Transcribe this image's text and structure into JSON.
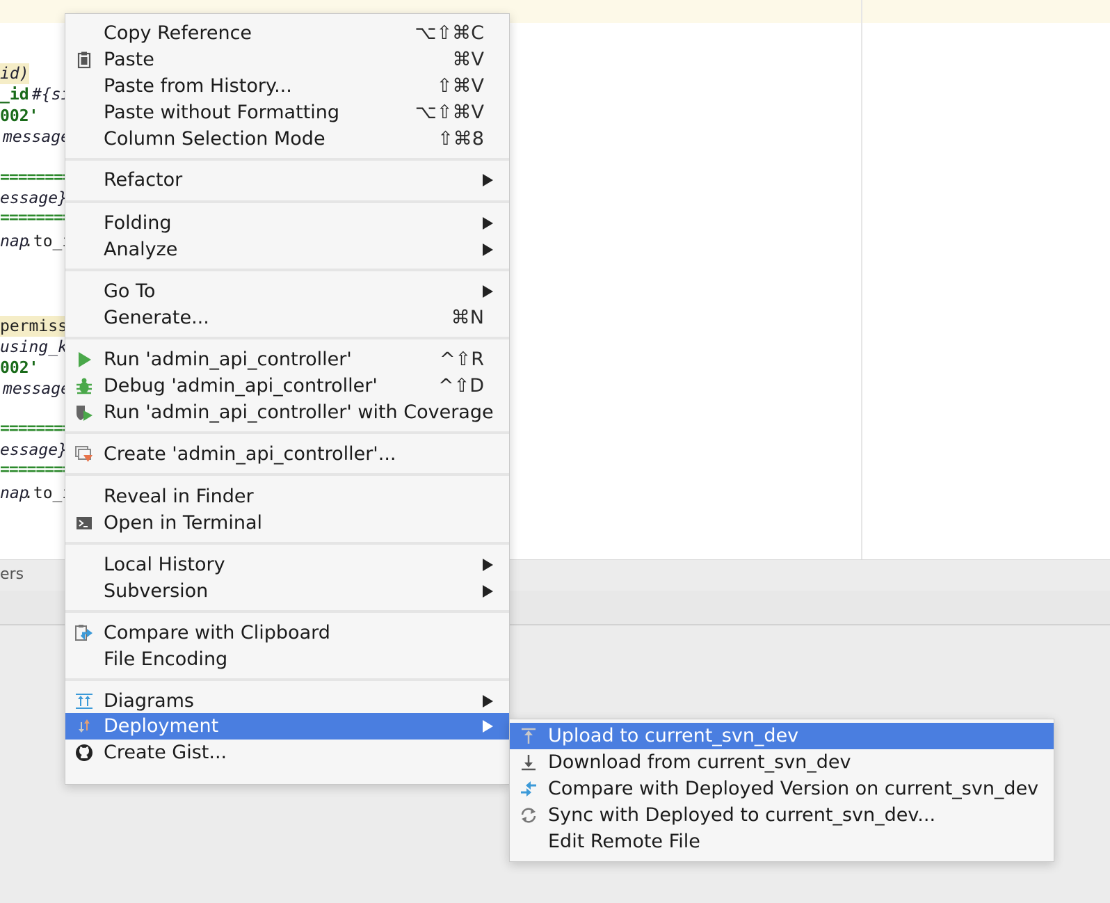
{
  "editor": {
    "code_fragments": [
      "id)",
      "_id",
      "#{si",
      "002'",
      "message",
      "essage}'",
      "nap",
      ".to_i",
      "permiss",
      "using_ke",
      "002'",
      "message",
      "essage}'",
      "nap",
      ".to_i"
    ],
    "separator_text": "=========="
  },
  "tool_window": {
    "tab_label": "ers"
  },
  "context_menu": {
    "items": [
      {
        "label": "Copy Reference",
        "shortcut": "⌥⇧⌘C"
      },
      {
        "label": "Paste",
        "shortcut": "⌘V",
        "icon": "clipboard-icon"
      },
      {
        "label": "Paste from History...",
        "shortcut": "⇧⌘V"
      },
      {
        "label": "Paste without Formatting",
        "shortcut": "⌥⇧⌘V"
      },
      {
        "label": "Column Selection Mode",
        "shortcut": "⇧⌘8"
      },
      {
        "label": "Refactor",
        "submenu": true
      },
      {
        "label": "Folding",
        "submenu": true
      },
      {
        "label": "Analyze",
        "submenu": true
      },
      {
        "label": "Go To",
        "submenu": true
      },
      {
        "label": "Generate...",
        "shortcut": "⌘N"
      },
      {
        "label": "Run 'admin_api_controller'",
        "shortcut": "^⇧R",
        "icon": "run-icon"
      },
      {
        "label": "Debug 'admin_api_controller'",
        "shortcut": "^⇧D",
        "icon": "debug-icon"
      },
      {
        "label": "Run 'admin_api_controller' with Coverage",
        "icon": "coverage-icon"
      },
      {
        "label": "Create 'admin_api_controller'...",
        "icon": "create-config-icon"
      },
      {
        "label": "Reveal in Finder"
      },
      {
        "label": "Open in Terminal",
        "icon": "terminal-icon"
      },
      {
        "label": "Local History",
        "submenu": true
      },
      {
        "label": "Subversion",
        "submenu": true
      },
      {
        "label": "Compare with Clipboard",
        "icon": "compare-clipboard-icon"
      },
      {
        "label": "File Encoding"
      },
      {
        "label": "Diagrams",
        "submenu": true,
        "icon": "diagrams-icon"
      },
      {
        "label": "Deployment",
        "submenu": true,
        "icon": "deployment-icon",
        "highlighted": true
      },
      {
        "label": "Create Gist...",
        "icon": "github-icon"
      }
    ]
  },
  "deployment_submenu": {
    "items": [
      {
        "label": "Upload to current_svn_dev",
        "icon": "upload-icon",
        "highlighted": true
      },
      {
        "label": "Download from current_svn_dev",
        "icon": "download-icon"
      },
      {
        "label": "Compare with Deployed Version on current_svn_dev",
        "icon": "compare-icon"
      },
      {
        "label": "Sync with Deployed to current_svn_dev...",
        "icon": "sync-icon"
      },
      {
        "label": "Edit Remote File"
      }
    ]
  },
  "colors": {
    "selection": "#4a7ee0",
    "menu_background": "#f6f6f6",
    "run_green": "#4aa84a",
    "accent_blue": "#3c9ad8",
    "accent_orange": "#e8744a"
  }
}
